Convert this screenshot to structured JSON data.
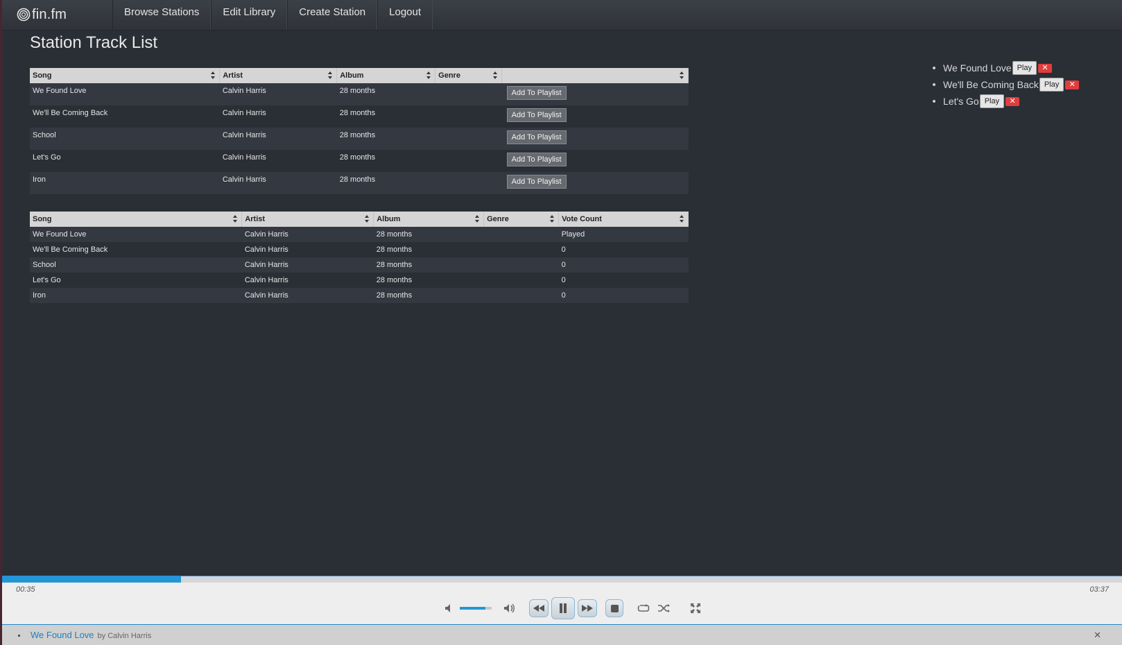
{
  "brand": {
    "name": "fin.fm"
  },
  "nav": {
    "items": [
      {
        "label": "Browse Stations"
      },
      {
        "label": "Edit Library"
      },
      {
        "label": "Create Station"
      },
      {
        "label": "Logout"
      }
    ]
  },
  "page": {
    "title": "Station Track List"
  },
  "library_table": {
    "headers": [
      "Song",
      "Artist",
      "Album",
      "Genre",
      ""
    ],
    "action_label": "Add To Playlist",
    "rows": [
      {
        "song": "We Found Love",
        "artist": "Calvin Harris",
        "album": "28 months",
        "genre": ""
      },
      {
        "song": "We'll Be Coming Back",
        "artist": "Calvin Harris",
        "album": "28 months",
        "genre": ""
      },
      {
        "song": "School",
        "artist": "Calvin Harris",
        "album": "28 months",
        "genre": ""
      },
      {
        "song": "Let's Go",
        "artist": "Calvin Harris",
        "album": "28 months",
        "genre": ""
      },
      {
        "song": "Iron",
        "artist": "Calvin Harris",
        "album": "28 months",
        "genre": ""
      }
    ]
  },
  "votes_table": {
    "headers": [
      "Song",
      "Artist",
      "Album",
      "Genre",
      "Vote Count"
    ],
    "rows": [
      {
        "song": "We Found Love",
        "artist": "Calvin Harris",
        "album": "28 months",
        "genre": "",
        "votes": "Played"
      },
      {
        "song": "We'll Be Coming Back",
        "artist": "Calvin Harris",
        "album": "28 months",
        "genre": "",
        "votes": "0"
      },
      {
        "song": "School",
        "artist": "Calvin Harris",
        "album": "28 months",
        "genre": "",
        "votes": "0"
      },
      {
        "song": "Let's Go",
        "artist": "Calvin Harris",
        "album": "28 months",
        "genre": "",
        "votes": "0"
      },
      {
        "song": "Iron",
        "artist": "Calvin Harris",
        "album": "28 months",
        "genre": "",
        "votes": "0"
      }
    ]
  },
  "playlist": {
    "play_label": "Play",
    "items": [
      {
        "title": "We Found Love"
      },
      {
        "title": "We'll Be Coming Back"
      },
      {
        "title": "Let's Go"
      }
    ]
  },
  "player": {
    "current_time": "00:35",
    "duration": "03:37",
    "progress": 0.16,
    "volume": 0.8,
    "accent_color": "#2396d8",
    "icons": [
      "mute-icon",
      "volume-max-icon",
      "previous-icon",
      "pause-icon",
      "next-icon",
      "stop-icon",
      "repeat-icon",
      "shuffle-icon",
      "fullscreen-icon"
    ]
  },
  "now_playing": {
    "title": "We Found Love",
    "by_label": "by",
    "artist": "Calvin Harris"
  }
}
